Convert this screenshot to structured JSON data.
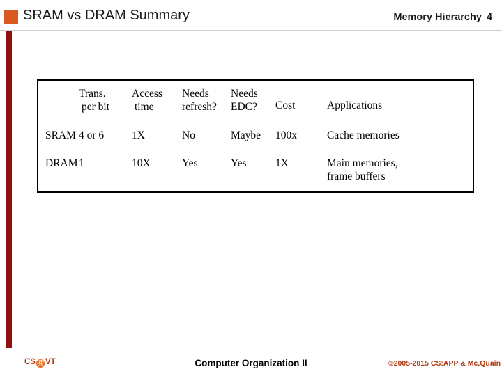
{
  "header": {
    "title": "SRAM vs DRAM Summary",
    "section": "Memory Hierarchy",
    "slide_number": "4",
    "accent_square_color": "#d85a1e"
  },
  "left_bar": {
    "color": "#8f1010"
  },
  "table": {
    "columns": [
      {
        "key": "label",
        "line1": "",
        "line2": ""
      },
      {
        "key": "trans",
        "line1": "Trans.",
        "line2": "per bit"
      },
      {
        "key": "access",
        "line1": "Access",
        "line2": "time"
      },
      {
        "key": "refresh",
        "line1": "Needs",
        "line2": "refresh?"
      },
      {
        "key": "edc",
        "line1": "Needs",
        "line2": "EDC?"
      },
      {
        "key": "cost",
        "line1": "Cost",
        "line2": ""
      },
      {
        "key": "apps",
        "line1": "Applications",
        "line2": ""
      }
    ],
    "rows": [
      {
        "label": "SRAM",
        "trans": "4 or 6",
        "access": "1X",
        "refresh": "No",
        "edc": "Maybe",
        "cost": "100x",
        "apps_line1": "Cache memories",
        "apps_line2": ""
      },
      {
        "label": "DRAM",
        "trans": "1",
        "access": "10X",
        "refresh": "Yes",
        "edc": "Yes",
        "cost": "1X",
        "apps_line1": "Main memories,",
        "apps_line2": "frame buffers"
      }
    ]
  },
  "footer": {
    "left_prefix": "CS",
    "left_badge": "@",
    "left_suffix": "VT",
    "center": "Computer Organization II",
    "right": "©2005-2015 CS:APP & Mc.Quain"
  }
}
